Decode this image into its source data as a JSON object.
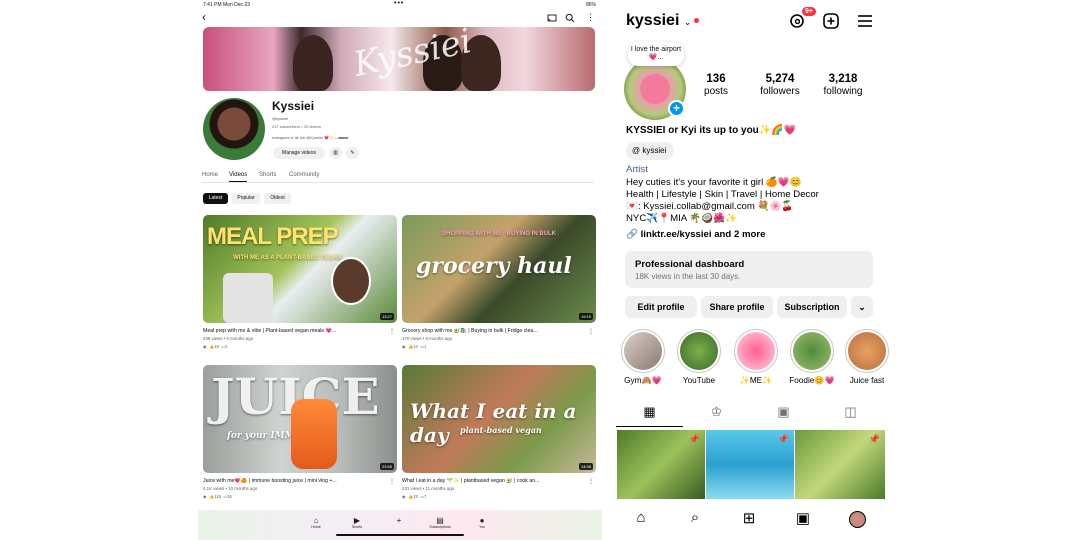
{
  "youtube": {
    "status": {
      "time": "7:41 PM  Mon Dec 23",
      "dots": "•••",
      "battery": "86%"
    },
    "banner_script": "Kyssiei",
    "channel": {
      "name": "Kyssiei",
      "handle": "@kyssiei",
      "stats": "237 subscribers • 20 videos",
      "bio": "Instagram & tik tok @Kyssiei 💗✨",
      "more": "...more",
      "manage_label": "Manage videos"
    },
    "tabs": [
      "Home",
      "Videos",
      "Shorts",
      "Community"
    ],
    "active_tab": "Videos",
    "chips": [
      "Latest",
      "Popular",
      "Oldest"
    ],
    "active_chip": "Latest",
    "videos": [
      {
        "title": "Meal prep with me & vibe | Plant-based vegan meals 💗...",
        "meta": "438 views • 6 months ago",
        "likes": "18",
        "comments": "2",
        "duration": "13:27",
        "overlay": "MEAL PREP",
        "overlay2": "WITH ME AS A PLANT-BASED VEGAN"
      },
      {
        "title": "Grocery shop with me 🥑🛍️ | Buying in bulk | Fridge clea...",
        "meta": "170 views • 8 months ago",
        "likes": "14",
        "comments": "1",
        "duration": "19:19",
        "overlay": "grocery haul",
        "overlay2": "SHOPPING WITH ME · BUYING IN BULK"
      },
      {
        "title": "Juice with me💗🍊 | immune boosting juice | mini vlog +...",
        "meta": "4.1K views • 10 months ago",
        "likes": "119",
        "comments": "16",
        "duration": "23:55",
        "overlay": "JUICE",
        "overlay2": "for your IMMUNITY"
      },
      {
        "title": "What I eat in a day 🌱✨ | plantbased vegan 🥑 | cook an...",
        "meta": "231 views • 11 months ago",
        "likes": "23",
        "comments": "7",
        "duration": "14:08",
        "overlay": "What I eat in a day",
        "overlay2": "plant-based vegan"
      }
    ],
    "nav": [
      "Home",
      "Shorts",
      "",
      "Subscriptions",
      "You"
    ]
  },
  "instagram": {
    "username": "kyssiei",
    "notifications": "9+",
    "note": "I love the airport 💗...",
    "stats": [
      {
        "n": "136",
        "l": "posts"
      },
      {
        "n": "5,274",
        "l": "followers"
      },
      {
        "n": "3,218",
        "l": "following"
      }
    ],
    "bio_name": "KYSSIEI or Kyi its up to you✨🌈💗",
    "threads_handle": "kyssiei",
    "category": "Artist",
    "bio_lines": [
      "Hey cuties it's your favorite it girl 🍊💗😊",
      "Health | Lifestyle | Skin | Travel | Home Decor",
      "💌: Kyssiei.collab@gmail.com 💐🌸🍒",
      "NYC✈️📍MIA 🌴🥥🌺✨"
    ],
    "link": "linktr.ee/kyssiei and 2 more",
    "dashboard": {
      "title": "Professional dashboard",
      "sub": "18K views in the last 30 days."
    },
    "buttons": [
      "Edit profile",
      "Share profile",
      "Subscription"
    ],
    "highlights": [
      "Gym🙈💗",
      "YouTube",
      "✨ME✨",
      "Foodie😊💗",
      "Juice fast"
    ],
    "colors": {
      "accent": "#0095f6",
      "badge": "#ff3040"
    }
  }
}
